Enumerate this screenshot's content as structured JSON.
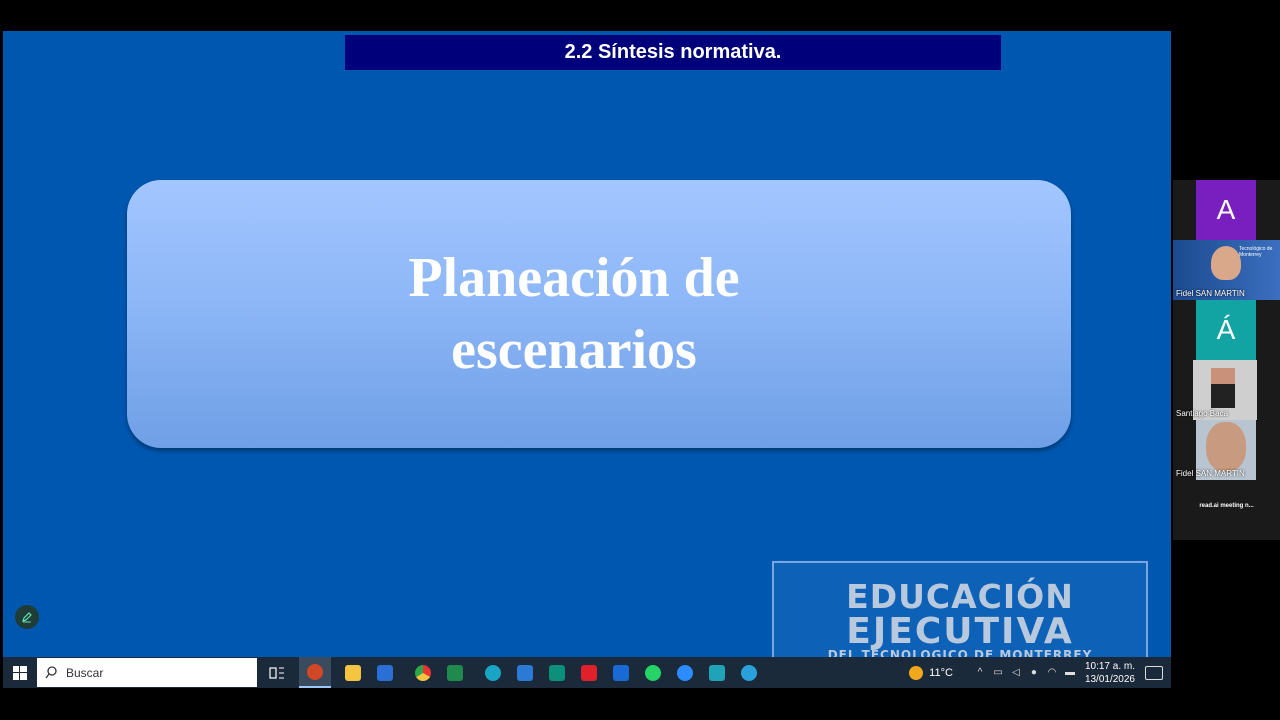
{
  "slide": {
    "header": "2.2 Síntesis normativa.",
    "title_line1": "Planeación de",
    "title_line2": "escenarios",
    "brand": {
      "line1": "EDUCACIÓN",
      "line2": "EJECUTIVA",
      "line3": "DEL TECNOLOGICO DE MONTERREY"
    }
  },
  "taskbar": {
    "search_placeholder": "Buscar",
    "temperature": "11°C",
    "time": "10:17 a. m.",
    "date": "13/01/2026",
    "apps": [
      "task-view",
      "powerpoint",
      "file-explorer",
      "word",
      "chrome",
      "excel",
      "edge",
      "outlook-mail",
      "publisher",
      "acrobat",
      "outlook",
      "whatsapp",
      "zoom",
      "webex",
      "telegram"
    ]
  },
  "participants": [
    {
      "initial": "A",
      "color": "#7a1fbf"
    },
    {
      "name": "Fidel SAN MARTIN",
      "logo": "Tecnológico de Monterrey"
    },
    {
      "initial": "Á",
      "color": "#12a3a3"
    },
    {
      "name": "Santiago Baca"
    },
    {
      "name": "Fidel SAN MARTIN"
    }
  ],
  "readai_label": "read.ai meeting n..."
}
